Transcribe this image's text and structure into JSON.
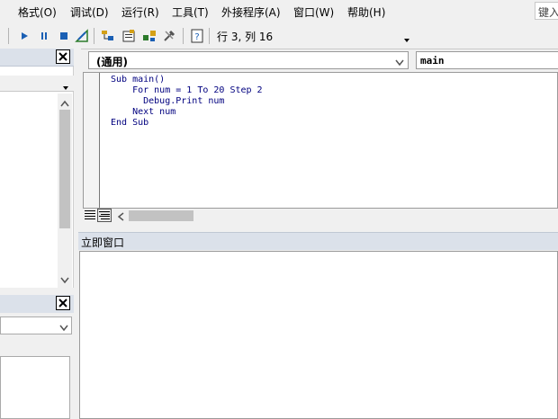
{
  "menu": {
    "items": [
      {
        "label": "格式(O)"
      },
      {
        "label": "调试(D)"
      },
      {
        "label": "运行(R)"
      },
      {
        "label": "工具(T)"
      },
      {
        "label": "外接程序(A)"
      },
      {
        "label": "窗口(W)"
      },
      {
        "label": "帮助(H)"
      }
    ],
    "search_text": "键入"
  },
  "toolbar": {
    "cursor_position": "行 3, 列 16"
  },
  "code_window": {
    "object_combo": "(通用)",
    "procedure_combo": "main",
    "lines": [
      "Sub main()",
      "    For num = 1 To 20 Step 2",
      "      Debug.Print num",
      "    Next num",
      "End Sub"
    ]
  },
  "immediate_window": {
    "title": "立即窗口"
  },
  "colors": {
    "panel_header": "#dbe1ea",
    "code_keyword": "#00007f",
    "toolbar_icon": "#1a5fb4"
  }
}
